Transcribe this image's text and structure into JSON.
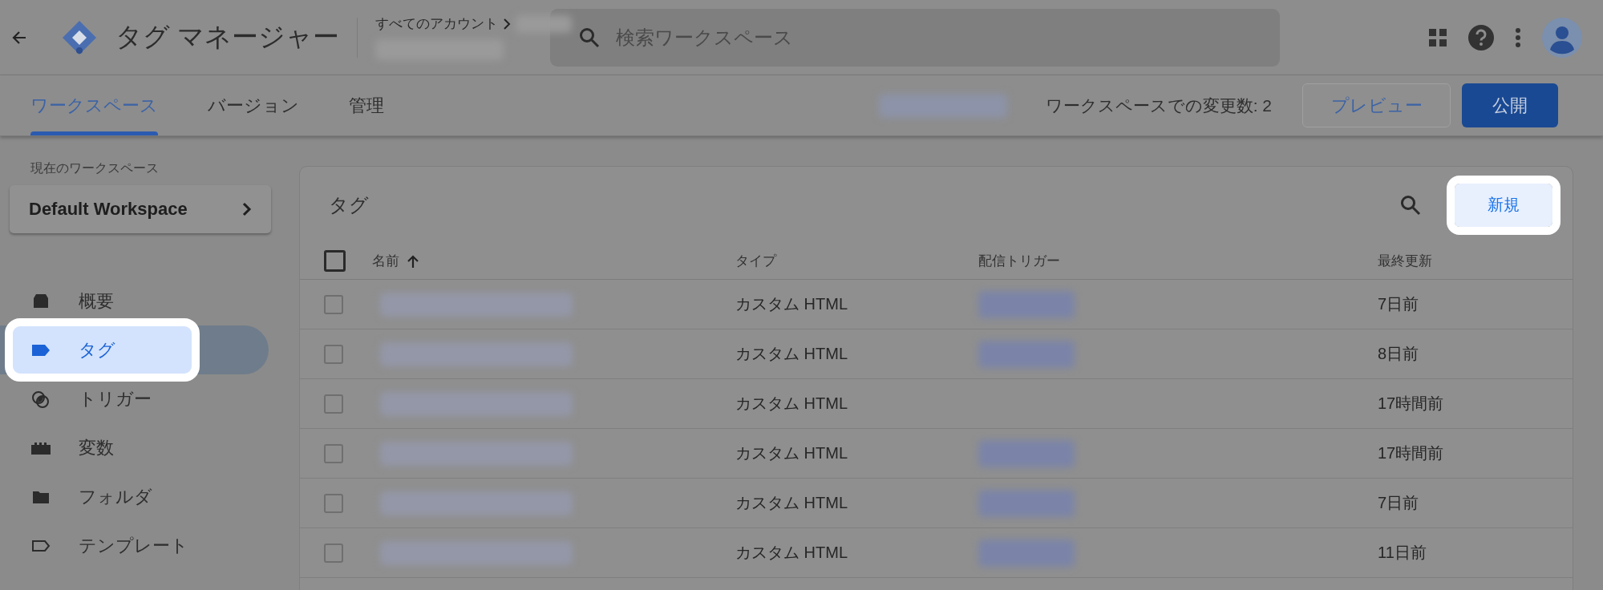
{
  "header": {
    "title": "タグ マネージャー",
    "breadcrumb": "すべてのアカウント",
    "search": {
      "placeholder": "検索ワークスペース"
    }
  },
  "tabs": [
    {
      "label": "ワークスペース",
      "selected": true
    },
    {
      "label": "バージョン",
      "selected": false
    },
    {
      "label": "管理",
      "selected": false
    }
  ],
  "workspace_bar": {
    "changes": "ワークスペースでの変更数: 2",
    "preview_button": "プレビュー",
    "publish_button": "公開"
  },
  "sidebar": {
    "label": "現在のワークスペース",
    "workspace": "Default Workspace",
    "items": [
      {
        "label": "概要",
        "kind": "overview",
        "selected": false,
        "highlighted": false
      },
      {
        "label": "タグ",
        "kind": "tag",
        "selected": true,
        "highlighted": true
      },
      {
        "label": "トリガー",
        "kind": "trigger",
        "selected": false,
        "highlighted": false
      },
      {
        "label": "変数",
        "kind": "variable",
        "selected": false,
        "highlighted": false
      },
      {
        "label": "フォルダ",
        "kind": "folder",
        "selected": false,
        "highlighted": false
      },
      {
        "label": "テンプレート",
        "kind": "template",
        "selected": false,
        "highlighted": false
      }
    ]
  },
  "tags_card": {
    "title": "タグ",
    "new_button": {
      "label": "新規",
      "highlighted": true
    },
    "select_all": {
      "checked": false
    },
    "columns": [
      "名前",
      "タイプ",
      "配信トリガー",
      "最終更新"
    ],
    "rows": [
      {
        "checked": false,
        "type": "カスタム HTML",
        "has_trigger": true,
        "updated": "7日前"
      },
      {
        "checked": false,
        "type": "カスタム HTML",
        "has_trigger": true,
        "updated": "8日前"
      },
      {
        "checked": false,
        "type": "カスタム HTML",
        "has_trigger": false,
        "updated": "17時間前"
      },
      {
        "checked": false,
        "type": "カスタム HTML",
        "has_trigger": true,
        "updated": "17時間前"
      },
      {
        "checked": false,
        "type": "カスタム HTML",
        "has_trigger": true,
        "updated": "7日前"
      },
      {
        "checked": false,
        "type": "カスタム HTML",
        "has_trigger": true,
        "updated": "11日前"
      }
    ]
  }
}
